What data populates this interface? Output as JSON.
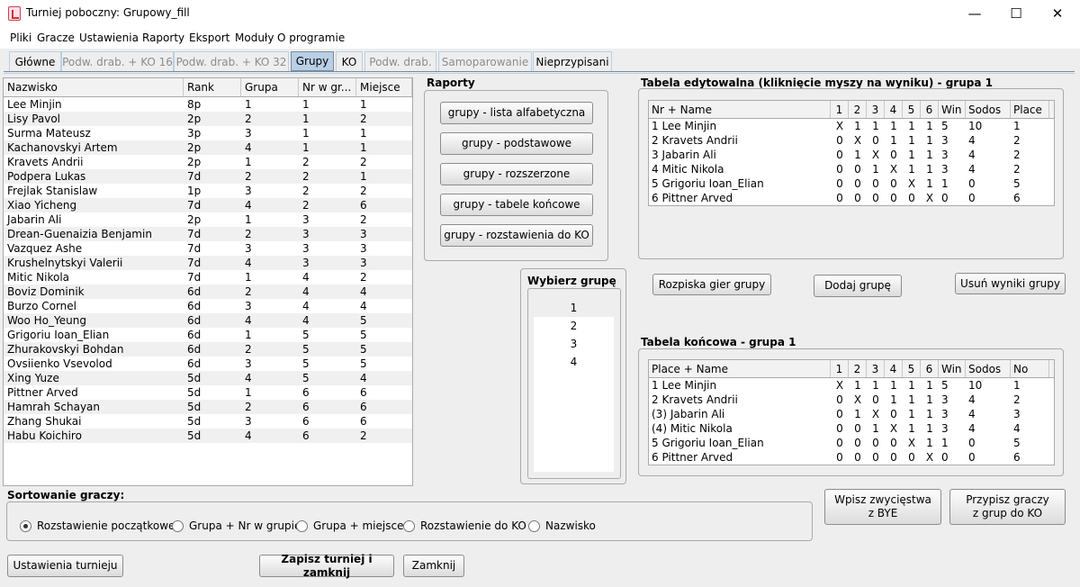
{
  "window": {
    "title": "Turniej poboczny: Grupowy_fill",
    "minimize": "—",
    "maximize": "☐",
    "close": "✕"
  },
  "menu": [
    "Pliki",
    "Gracze",
    "Ustawienia",
    "Raporty",
    "Eksport",
    "Moduły",
    "O programie"
  ],
  "tabs": [
    {
      "label": "Główne",
      "state": "normal"
    },
    {
      "label": "Podw. drab. + KO 16",
      "state": "disabled"
    },
    {
      "label": "Podw. drab. + KO 32",
      "state": "disabled"
    },
    {
      "label": "Grupy",
      "state": "active"
    },
    {
      "label": "KO",
      "state": "normal"
    },
    {
      "label": "Podw. drab.",
      "state": "disabled"
    },
    {
      "label": "Samoparowanie",
      "state": "disabled"
    },
    {
      "label": "Nieprzypisani",
      "state": "normal"
    }
  ],
  "players": {
    "headers": [
      "Nazwisko",
      "Rank",
      "Grupa",
      "Nr w gr...",
      "Miejsce"
    ],
    "rows": [
      [
        "Lee Minjin",
        "8p",
        "1",
        "1",
        "1"
      ],
      [
        "Lisy Pavol",
        "2p",
        "2",
        "1",
        "2"
      ],
      [
        "Surma Mateusz",
        "3p",
        "3",
        "1",
        "1"
      ],
      [
        "Kachanovskyi Artem",
        "2p",
        "4",
        "1",
        "1"
      ],
      [
        "Kravets Andrii",
        "2p",
        "1",
        "2",
        "2"
      ],
      [
        "Podpera Lukas",
        "7d",
        "2",
        "2",
        "1"
      ],
      [
        "Frejlak Stanislaw",
        "1p",
        "3",
        "2",
        "2"
      ],
      [
        "Xiao Yicheng",
        "7d",
        "4",
        "2",
        "6"
      ],
      [
        "Jabarin Ali",
        "2p",
        "1",
        "3",
        "2"
      ],
      [
        "Drean-Guenaizia Benjamin",
        "7d",
        "2",
        "3",
        "3"
      ],
      [
        "Vazquez Ashe",
        "7d",
        "3",
        "3",
        "3"
      ],
      [
        "Krushelnytskyi Valerii",
        "7d",
        "4",
        "3",
        "3"
      ],
      [
        "Mitic Nikola",
        "7d",
        "1",
        "4",
        "2"
      ],
      [
        "Boviz Dominik",
        "6d",
        "2",
        "4",
        "4"
      ],
      [
        "Burzo Cornel",
        "6d",
        "3",
        "4",
        "4"
      ],
      [
        "Woo Ho_Yeung",
        "6d",
        "4",
        "4",
        "5"
      ],
      [
        "Grigoriu Ioan_Elian",
        "6d",
        "1",
        "5",
        "5"
      ],
      [
        "Zhurakovskyi Bohdan",
        "6d",
        "2",
        "5",
        "5"
      ],
      [
        "Ovsiienko Vsevolod",
        "6d",
        "3",
        "5",
        "5"
      ],
      [
        "Xing Yuze",
        "5d",
        "4",
        "5",
        "4"
      ],
      [
        "Pittner Arved",
        "5d",
        "1",
        "6",
        "6"
      ],
      [
        "Hamrah Schayan",
        "5d",
        "2",
        "6",
        "6"
      ],
      [
        "Zhang Shukai",
        "5d",
        "3",
        "6",
        "6"
      ],
      [
        "Habu Koichiro",
        "5d",
        "4",
        "6",
        "2"
      ]
    ]
  },
  "reports": {
    "title": "Raporty",
    "buttons": [
      "grupy - lista alfabetyczna",
      "grupy - podstawowe",
      "grupy - rozszerzone",
      "grupy - tabele końcowe",
      "grupy - rozstawienia do KO"
    ]
  },
  "group_select": {
    "title": "Wybierz grupę",
    "items": [
      "1",
      "2",
      "3",
      "4"
    ],
    "selected": "1"
  },
  "editable": {
    "title": "Tabela edytowalna (kliknięcie myszy na wyniku) - grupa 1",
    "headers": [
      "Nr + Name",
      "1",
      "2",
      "3",
      "4",
      "5",
      "6",
      "Win",
      "Sodos",
      "Place"
    ],
    "rows": [
      [
        "1 Lee Minjin",
        "X",
        "1",
        "1",
        "1",
        "1",
        "1",
        "5",
        "10",
        "1"
      ],
      [
        "2 Kravets Andrii",
        "0",
        "X",
        "0",
        "1",
        "1",
        "1",
        "3",
        "4",
        "2"
      ],
      [
        "3 Jabarin Ali",
        "0",
        "1",
        "X",
        "0",
        "1",
        "1",
        "3",
        "4",
        "2"
      ],
      [
        "4 Mitic Nikola",
        "0",
        "0",
        "1",
        "X",
        "1",
        "1",
        "3",
        "4",
        "2"
      ],
      [
        "5 Grigoriu Ioan_Elian",
        "0",
        "0",
        "0",
        "0",
        "X",
        "1",
        "1",
        "0",
        "5"
      ],
      [
        "6 Pittner Arved",
        "0",
        "0",
        "0",
        "0",
        "0",
        "X",
        "0",
        "0",
        "6"
      ]
    ]
  },
  "mid_buttons": {
    "schedule": "Rozpiska gier grupy",
    "add": "Dodaj grupę",
    "remove": "Usuń wyniki grupy"
  },
  "final": {
    "title": "Tabela końcowa - grupa 1",
    "headers": [
      "Place + Name",
      "1",
      "2",
      "3",
      "4",
      "5",
      "6",
      "Win",
      "Sodos",
      "No"
    ],
    "rows": [
      [
        "1 Lee Minjin",
        "X",
        "1",
        "1",
        "1",
        "1",
        "1",
        "5",
        "10",
        "1"
      ],
      [
        "2 Kravets Andrii",
        "0",
        "X",
        "0",
        "1",
        "1",
        "1",
        "3",
        "4",
        "2"
      ],
      [
        "(3) Jabarin Ali",
        "0",
        "1",
        "X",
        "0",
        "1",
        "1",
        "3",
        "4",
        "3"
      ],
      [
        "(4) Mitic Nikola",
        "0",
        "0",
        "1",
        "X",
        "1",
        "1",
        "3",
        "4",
        "4"
      ],
      [
        "5 Grigoriu Ioan_Elian",
        "0",
        "0",
        "0",
        "0",
        "X",
        "1",
        "1",
        "0",
        "5"
      ],
      [
        "6 Pittner Arved",
        "0",
        "0",
        "0",
        "0",
        "0",
        "X",
        "0",
        "0",
        "6"
      ]
    ]
  },
  "sorting": {
    "title": "Sortowanie graczy:",
    "options": [
      "Rozstawienie początkowe",
      "Grupa + Nr w grupie",
      "Grupa + miejsce",
      "Rozstawienie do KO",
      "Nazwisko"
    ],
    "selected": 0
  },
  "right_buttons": {
    "bye_line1": "Wpisz zwycięstwa",
    "bye_line2": "z BYE",
    "assign_line1": "Przypisz graczy",
    "assign_line2": "z grup do KO"
  },
  "bottom": {
    "settings": "Ustawienia turnieju",
    "save": "Zapisz turniej i zamknij",
    "close": "Zamknij"
  }
}
